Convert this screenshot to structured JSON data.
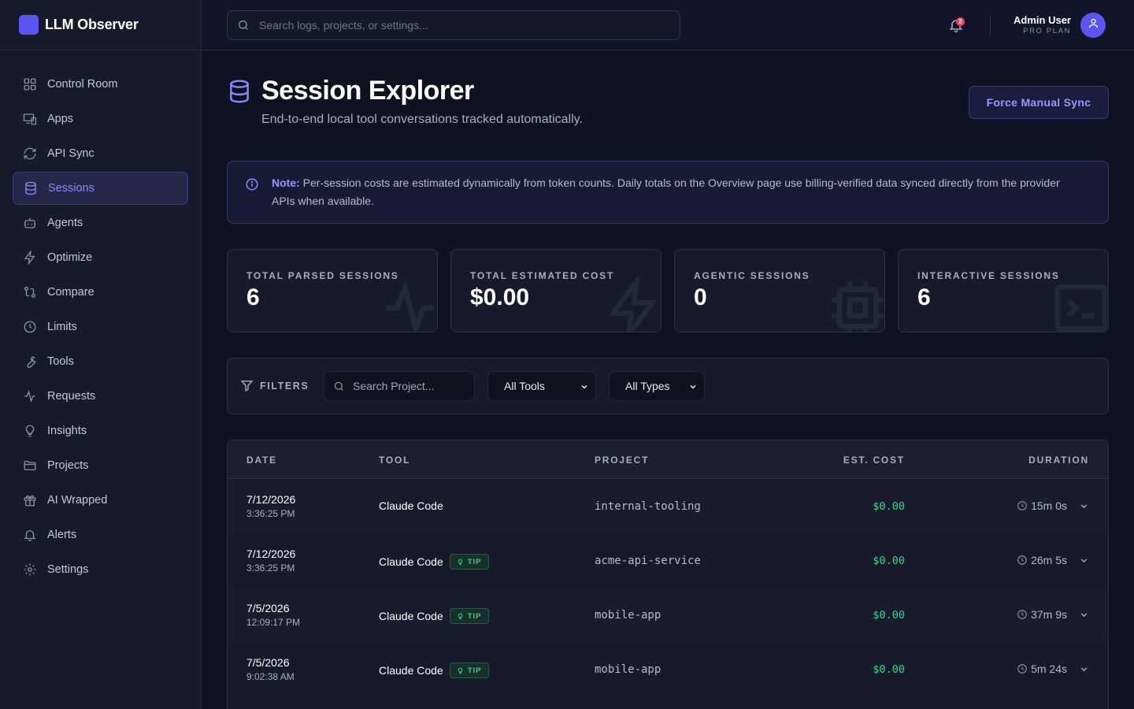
{
  "app": {
    "name": "LLM Observer"
  },
  "search": {
    "placeholder": "Search logs, projects, or settings..."
  },
  "notifications": {
    "count": "2"
  },
  "user": {
    "name": "Admin User",
    "plan": "PRO PLAN"
  },
  "sidebar": {
    "items": [
      {
        "label": "Control Room",
        "icon": "grid-icon"
      },
      {
        "label": "Apps",
        "icon": "devices-icon"
      },
      {
        "label": "API Sync",
        "icon": "refresh-icon"
      },
      {
        "label": "Sessions",
        "icon": "database-icon",
        "active": true
      },
      {
        "label": "Agents",
        "icon": "bot-icon"
      },
      {
        "label": "Optimize",
        "icon": "lightning-icon"
      },
      {
        "label": "Compare",
        "icon": "compare-icon"
      },
      {
        "label": "Limits",
        "icon": "clock-icon"
      },
      {
        "label": "Tools",
        "icon": "wrench-icon"
      },
      {
        "label": "Requests",
        "icon": "activity-icon"
      },
      {
        "label": "Insights",
        "icon": "lightbulb-icon"
      },
      {
        "label": "Projects",
        "icon": "folder-icon"
      },
      {
        "label": "AI Wrapped",
        "icon": "gift-icon"
      },
      {
        "label": "Alerts",
        "icon": "bell-icon"
      },
      {
        "label": "Settings",
        "icon": "gear-icon"
      }
    ]
  },
  "page": {
    "title": "Session Explorer",
    "subtitle": "End-to-end local tool conversations tracked automatically.",
    "sync_button": "Force Manual Sync"
  },
  "note": {
    "label": "Note:",
    "text": " Per-session costs are estimated dynamically from token counts. Daily totals on the Overview page use billing-verified data synced directly from the provider APIs when available."
  },
  "stats": [
    {
      "label": "TOTAL PARSED SESSIONS",
      "value": "6",
      "icon": "activity-icon"
    },
    {
      "label": "TOTAL ESTIMATED COST",
      "value": "$0.00",
      "icon": "lightning-icon"
    },
    {
      "label": "AGENTIC SESSIONS",
      "value": "0",
      "icon": "cpu-icon"
    },
    {
      "label": "INTERACTIVE SESSIONS",
      "value": "6",
      "icon": "terminal-icon"
    }
  ],
  "filters": {
    "label": "FILTERS",
    "search_placeholder": "Search Project...",
    "tool_select": "All Tools",
    "type_select": "All Types"
  },
  "table": {
    "columns": [
      "DATE",
      "TOOL",
      "PROJECT",
      "EST. COST",
      "DURATION"
    ],
    "tip_label": "TIP",
    "rows": [
      {
        "date": "7/12/2026",
        "time": "3:36:25 PM",
        "tool": "Claude Code",
        "tip": false,
        "project": "internal-tooling",
        "cost": "$0.00",
        "duration": "15m 0s"
      },
      {
        "date": "7/12/2026",
        "time": "3:36:25 PM",
        "tool": "Claude Code",
        "tip": true,
        "project": "acme-api-service",
        "cost": "$0.00",
        "duration": "26m 5s"
      },
      {
        "date": "7/5/2026",
        "time": "12:09:17 PM",
        "tool": "Claude Code",
        "tip": true,
        "project": "mobile-app",
        "cost": "$0.00",
        "duration": "37m 9s"
      },
      {
        "date": "7/5/2026",
        "time": "9:02:38 AM",
        "tool": "Claude Code",
        "tip": true,
        "project": "mobile-app",
        "cost": "$0.00",
        "duration": "5m 24s"
      }
    ]
  },
  "colors": {
    "accent": "#5b54f0",
    "accent_text": "#8f87ff",
    "success": "#3ecf8e",
    "background": "#0f1220"
  }
}
